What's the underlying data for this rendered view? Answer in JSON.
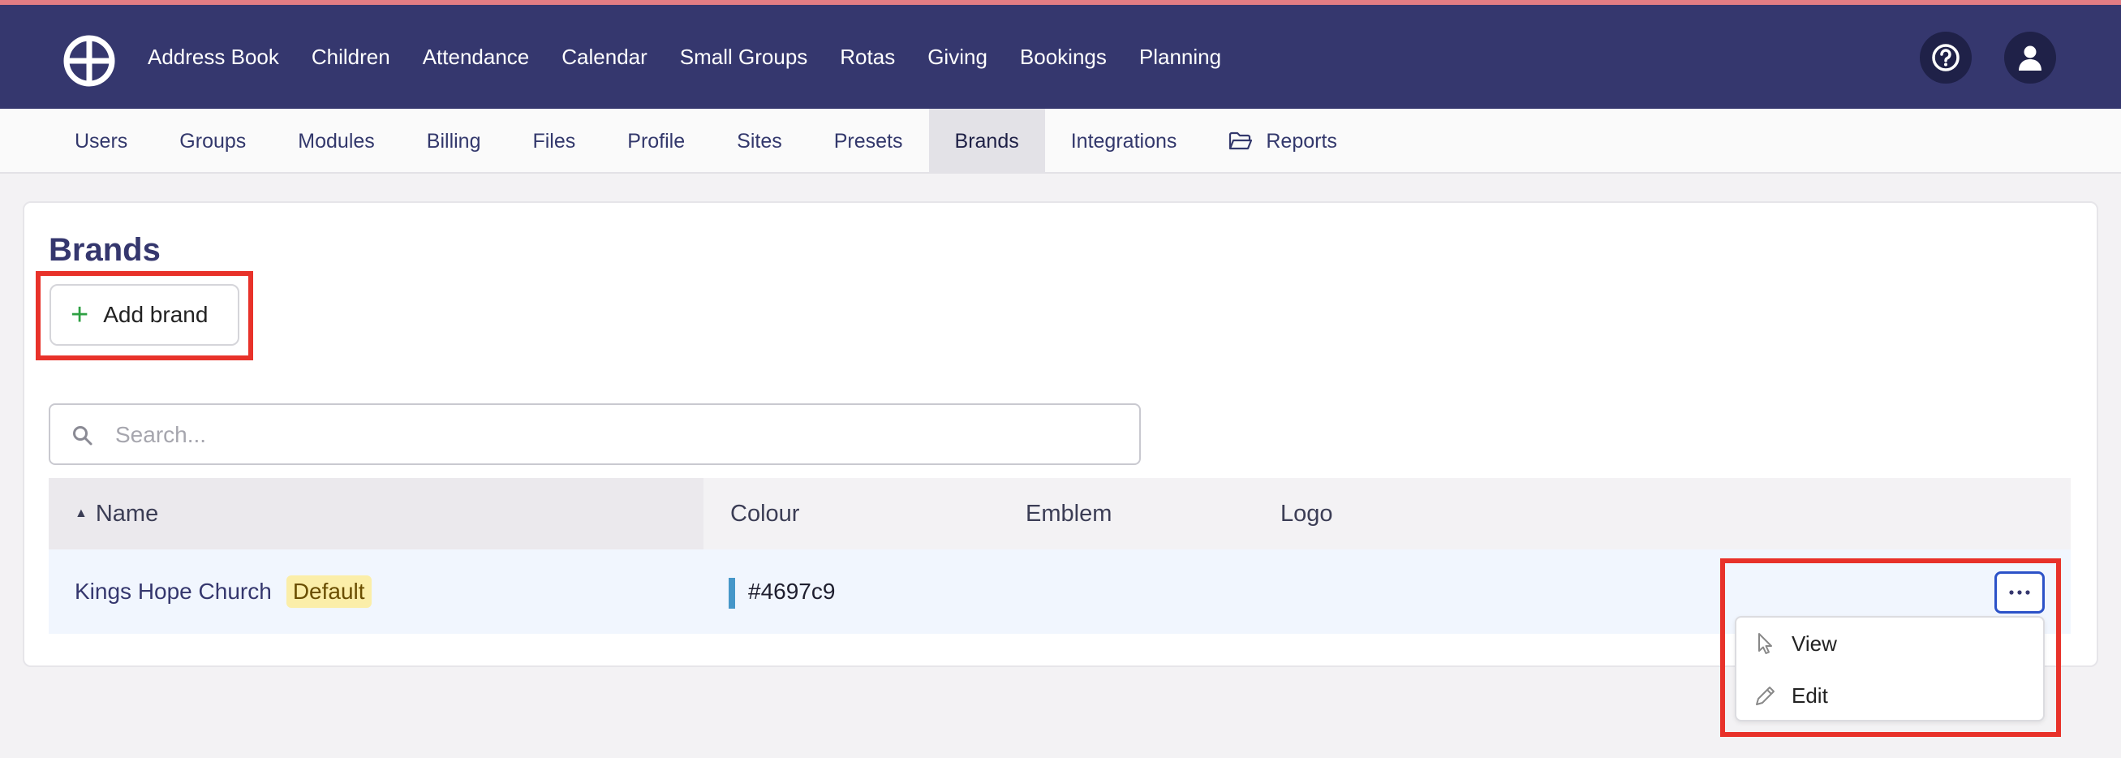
{
  "colors": {
    "topbar": "#35376e",
    "accent_line": "#e27d84",
    "highlight": "#e8322a",
    "brand_colour": "#4697c9"
  },
  "topbar": {
    "logo_icon": "wheel-logo-icon",
    "nav": [
      "Address Book",
      "Children",
      "Attendance",
      "Calendar",
      "Small Groups",
      "Rotas",
      "Giving",
      "Bookings",
      "Planning"
    ],
    "help_icon": "question-circle-icon",
    "user_icon": "user-icon"
  },
  "subnav": {
    "tabs": [
      "Users",
      "Groups",
      "Modules",
      "Billing",
      "Files",
      "Profile",
      "Sites",
      "Presets",
      "Brands",
      "Integrations",
      "Reports"
    ],
    "active": "Brands",
    "reports_icon": "folder-open-icon"
  },
  "page": {
    "title": "Brands",
    "add_button": "Add brand",
    "search_placeholder": "Search..."
  },
  "table": {
    "columns": [
      "Name",
      "Colour",
      "Emblem",
      "Logo"
    ],
    "sort_indicator": "sort-ascending-icon",
    "rows": [
      {
        "name": "Kings Hope Church",
        "badge": "Default",
        "colour": "#4697c9",
        "emblem": "",
        "logo": ""
      }
    ]
  },
  "row_menu": {
    "trigger_icon": "ellipsis-icon",
    "items": [
      {
        "label": "View",
        "icon": "pointer-icon"
      },
      {
        "label": "Edit",
        "icon": "pencil-icon"
      }
    ]
  }
}
